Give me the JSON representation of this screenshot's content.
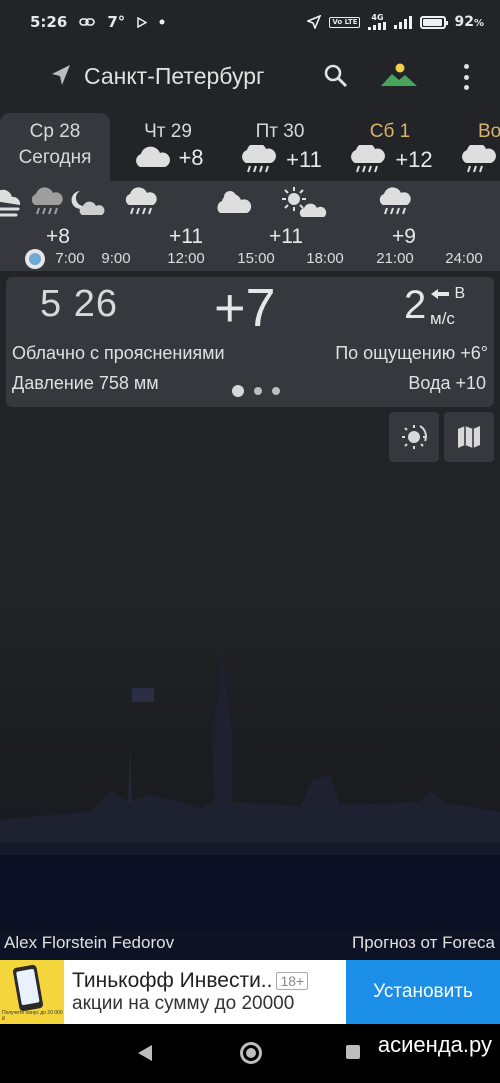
{
  "status": {
    "time": "5:26",
    "temp": "7°",
    "battery": "92",
    "battery_unit": "%",
    "network": "4G",
    "volte": "Vo LTE",
    "battery_level": 0.92
  },
  "appbar": {
    "city": "Санкт-Петербург",
    "icons": [
      "navigation-arrow-icon",
      "search-icon",
      "landscape-icon",
      "more-vert-icon"
    ]
  },
  "days": [
    {
      "name": "Ср 28",
      "sub": "Сегодня",
      "temp": "",
      "icon": "cloud-icon",
      "active": true
    },
    {
      "name": "Чт 29",
      "sub": "",
      "temp": "+8",
      "icon": "cloud-icon"
    },
    {
      "name": "Пт 30",
      "sub": "",
      "temp": "+11",
      "icon": "rain-cloud-icon"
    },
    {
      "name": "Сб 1",
      "sub": "",
      "temp": "+12",
      "icon": "rain-cloud-icon",
      "weekend": true
    },
    {
      "name": "Во",
      "sub": "",
      "temp": "",
      "icon": "rain-cloud-icon",
      "weekend": true
    }
  ],
  "hourly": {
    "values": [
      "+8",
      "+11",
      "+11",
      "+9"
    ],
    "times": [
      "7:00",
      "9:00",
      "12:00",
      "15:00",
      "18:00",
      "21:00",
      "24:00"
    ]
  },
  "current": {
    "time": "5 26",
    "temp": "+7",
    "wind_speed": "2",
    "wind_dir": "В",
    "wind_unit": "м/с",
    "condition": "Облачно с прояснениями",
    "feels_like": "По ощущению +6°",
    "pressure": "Давление 758 мм",
    "water": "Вода +10"
  },
  "credits": {
    "photo_author": "Alex Florstein Fedorov",
    "forecast_source": "Прогноз от Foreca"
  },
  "ad": {
    "title": "Тинькофф Инвести..",
    "age": "18+",
    "desc": "акции на сумму до 20000",
    "thumb_caption": "Получите бонус до 20 000 ₽",
    "install": "Установить"
  },
  "watermark": "асиенда.ру",
  "colors": {
    "panel": "#36383d",
    "weekend": "#d9b36a",
    "accent_button": "#1b8ee8",
    "now_dot": "#6ea9d6"
  }
}
